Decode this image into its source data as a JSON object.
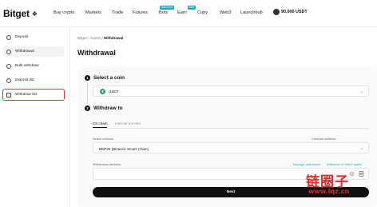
{
  "brand": {
    "name": "Bitget",
    "mark": "❖"
  },
  "nav": {
    "items": [
      "Buy crypto",
      "Markets",
      "Trade",
      "Futures",
      "Bots",
      "Earn",
      "Copy",
      "Web3",
      "Launchhub"
    ],
    "bots_badge": "Discounts",
    "earn_badge": "New",
    "balance": "90,000 USDT"
  },
  "sidebar": {
    "items": [
      {
        "label": "Deposit",
        "icon": "deposit-icon"
      },
      {
        "label": "Withdrawal",
        "icon": "withdrawal-icon"
      },
      {
        "label": "Bulk withdraw",
        "icon": "bulk-withdraw-icon"
      },
      {
        "label": "Deposit list",
        "icon": "list-icon"
      },
      {
        "label": "Withdraw list",
        "icon": "withdraw-list-icon"
      }
    ]
  },
  "breadcrumb": {
    "root": "Bitget",
    "sep": "/",
    "assets": "Assets",
    "current": "Withdrawal"
  },
  "page": {
    "title": "Withdrawal"
  },
  "step1": {
    "num": "1",
    "title": "Select a coin",
    "coin": "USDT",
    "coin_icon_glyph": "₮"
  },
  "step2": {
    "num": "2",
    "title": "Withdraw to",
    "tabs": [
      "On chain",
      "Internal transfer"
    ],
    "network_label": "Select network",
    "contract_label": "Contract address",
    "network_value": "BEP20 (Binance Smart Chain)",
    "address_label": "Withdrawal address",
    "manage_link": "Manage addresses",
    "web3_link": "Withdraw to Web3 wallet",
    "address_placeholder": "",
    "next_label": "Next"
  },
  "watermark": {
    "text": "链圈子",
    "url": "www.lqz.cn"
  },
  "colors": {
    "accent": "#1aa6c7",
    "usdt": "#26a17b",
    "highlight": "#d63a3a"
  }
}
